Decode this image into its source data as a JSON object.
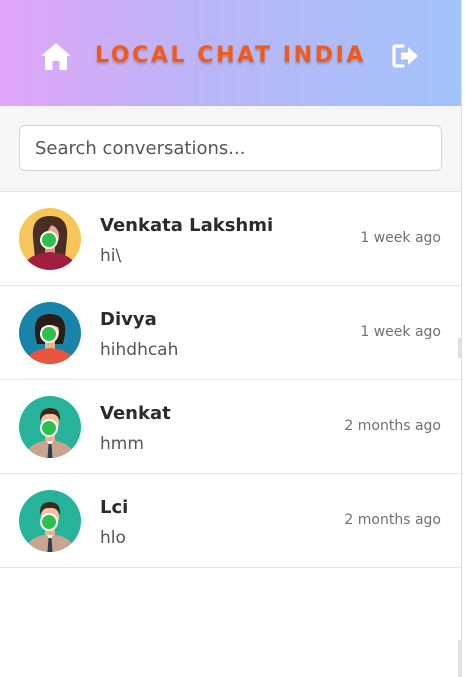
{
  "header": {
    "title": "LOCAL CHAT INDIA",
    "home_icon": "home-icon",
    "logout_icon": "logout-icon"
  },
  "search": {
    "placeholder": "Search conversations..."
  },
  "colors": {
    "title": "#f05a1a",
    "online": "#2ec04d",
    "header_gradient_start": "#e0a6f7",
    "header_gradient_end": "#a3c3fb"
  },
  "conversations": [
    {
      "name": "Venkata Lakshmi",
      "last_message": "hi\\",
      "time": "1 week ago",
      "online": true,
      "avatar": "female-avatar-icon"
    },
    {
      "name": "Divya",
      "last_message": "hihdhcah",
      "time": "1 week ago",
      "online": true,
      "avatar": "female-avatar-icon"
    },
    {
      "name": "Venkat",
      "last_message": "hmm",
      "time": "2 months ago",
      "online": true,
      "avatar": "male-avatar-icon"
    },
    {
      "name": "Lci",
      "last_message": "hlo",
      "time": "2 months ago",
      "online": true,
      "avatar": "male-avatar-icon"
    }
  ]
}
